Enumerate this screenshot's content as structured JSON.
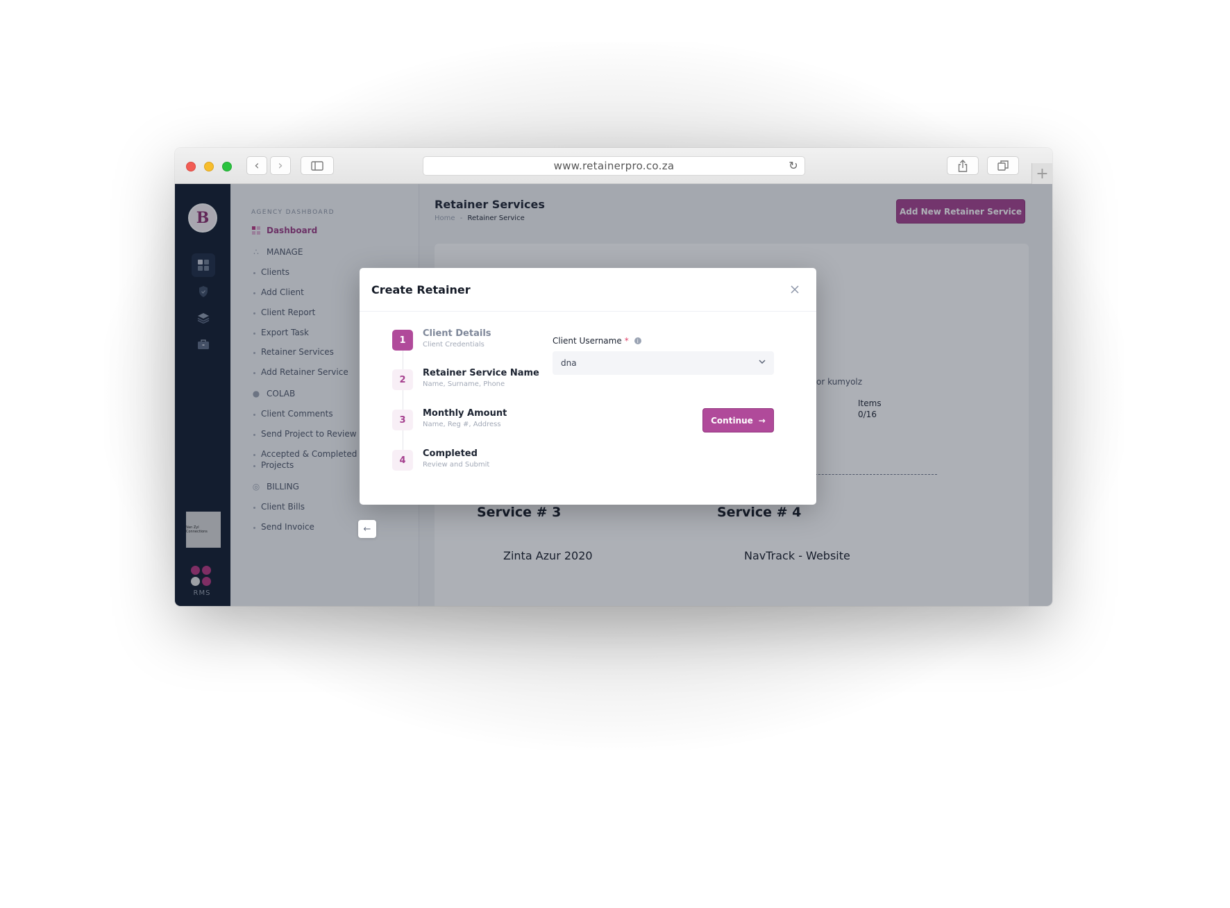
{
  "browser": {
    "url": "www.retainerpro.co.za",
    "icons": {
      "back": "chevron-left-icon",
      "forward": "chevron-right-icon",
      "sidebar": "sidebar-icon",
      "reload": "reload-icon",
      "share": "share-icon",
      "tabs": "tabs-icon",
      "new_tab": "plus-icon"
    }
  },
  "rail": {
    "logo_letter": "B",
    "brand_thumb_text": "Van Zyl Connections",
    "rms_label": "RMS",
    "icons": [
      "dashboard-icon",
      "shield-icon",
      "layers-icon",
      "briefcase-icon"
    ]
  },
  "nav": {
    "section_label": "AGENCY DASHBOARD",
    "dashboard": "Dashboard",
    "manage": "MANAGE",
    "manage_items": [
      "Clients",
      "Add Client",
      "Client Report",
      "Export Task",
      "Retainer Services",
      "Add Retainer Service"
    ],
    "colab": "COLAB",
    "colab_items": [
      "Client Comments",
      "Send Project to Review",
      "Accepted & Completed",
      "Projects"
    ],
    "billing": "BILLING",
    "billing_items": [
      "Client Bills",
      "Send Invoice"
    ]
  },
  "header": {
    "title": "Retainer Services",
    "breadcrumb_home": "Home",
    "breadcrumb_sep": "-",
    "breadcrumb_current": "Retainer Service",
    "add_button": "Add New Retainer Service"
  },
  "background": {
    "owner_text": "or kumyolz",
    "items_label": "Items",
    "items_value": "0/16",
    "service3_title": "Service # 3",
    "service3_sub": "Zinta Azur 2020",
    "service4_title": "Service # 4",
    "service4_sub": "NavTrack - Website"
  },
  "modal": {
    "title": "Create Retainer",
    "steps": [
      {
        "num": "1",
        "title": "Client Details",
        "desc": "Client Credentials"
      },
      {
        "num": "2",
        "title": "Retainer Service Name",
        "desc": "Name, Surname, Phone"
      },
      {
        "num": "3",
        "title": "Monthly Amount",
        "desc": "Name, Reg #, Address"
      },
      {
        "num": "4",
        "title": "Completed",
        "desc": "Review and Submit"
      }
    ],
    "field_label": "Client Username",
    "required_mark": "*",
    "select_value": "dna",
    "continue_label": "Continue"
  },
  "colors": {
    "brand": "#a53f8e",
    "rail": "#0f1a2c",
    "required": "#e0446a"
  }
}
